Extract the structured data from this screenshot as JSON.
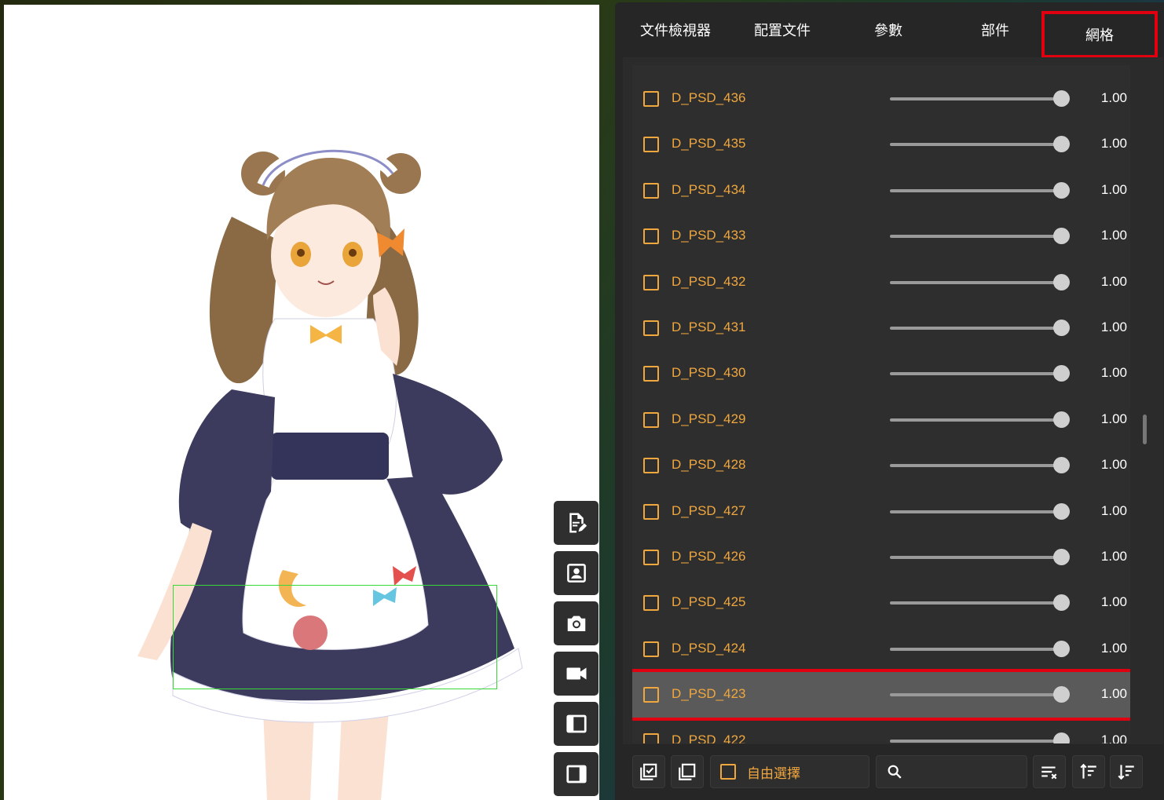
{
  "tabs": [
    {
      "label": "文件檢視器"
    },
    {
      "label": "配置文件"
    },
    {
      "label": "參數"
    },
    {
      "label": "部件"
    },
    {
      "label": "網格",
      "active": true
    }
  ],
  "meshes": [
    {
      "name": "D_PSD_436",
      "value": "1.00",
      "level": 1.0
    },
    {
      "name": "D_PSD_435",
      "value": "1.00",
      "level": 1.0
    },
    {
      "name": "D_PSD_434",
      "value": "1.00",
      "level": 1.0
    },
    {
      "name": "D_PSD_433",
      "value": "1.00",
      "level": 1.0
    },
    {
      "name": "D_PSD_432",
      "value": "1.00",
      "level": 1.0
    },
    {
      "name": "D_PSD_431",
      "value": "1.00",
      "level": 1.0
    },
    {
      "name": "D_PSD_430",
      "value": "1.00",
      "level": 1.0
    },
    {
      "name": "D_PSD_429",
      "value": "1.00",
      "level": 1.0
    },
    {
      "name": "D_PSD_428",
      "value": "1.00",
      "level": 1.0
    },
    {
      "name": "D_PSD_427",
      "value": "1.00",
      "level": 1.0
    },
    {
      "name": "D_PSD_426",
      "value": "1.00",
      "level": 1.0
    },
    {
      "name": "D_PSD_425",
      "value": "1.00",
      "level": 1.0
    },
    {
      "name": "D_PSD_424",
      "value": "1.00",
      "level": 1.0
    },
    {
      "name": "D_PSD_423",
      "value": "1.00",
      "level": 1.0,
      "highlighted": true
    },
    {
      "name": "D_PSD_422",
      "value": "1.00",
      "level": 1.0
    }
  ],
  "toolbar": {
    "free_select_label": "自由選擇",
    "search_placeholder": ""
  },
  "colors": {
    "accent": "#f0a73e",
    "highlight_border": "#e0000f",
    "selection_box": "#38d838"
  },
  "canvas_tools": [
    "edit-document-icon",
    "portrait-icon",
    "camera-icon",
    "video-camera-icon",
    "panel-left-icon",
    "panel-right-icon"
  ]
}
